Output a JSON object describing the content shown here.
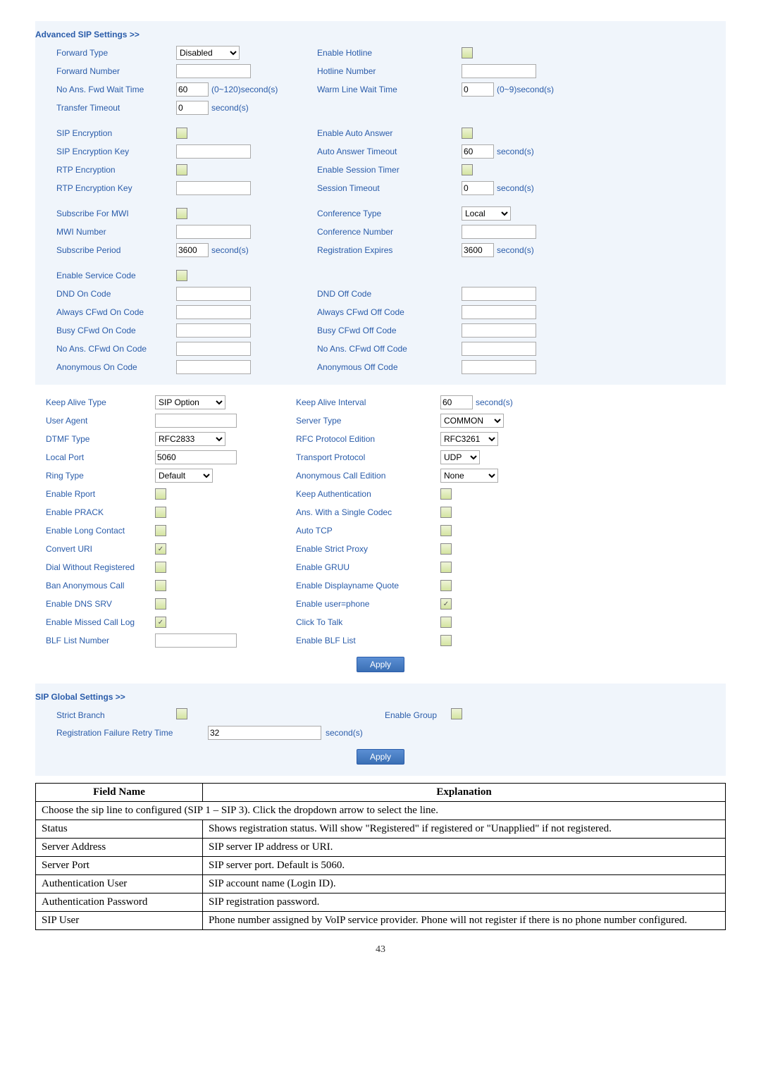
{
  "adv_header": "Advanced SIP Settings >>",
  "labels": {
    "forward_type": "Forward Type",
    "forward_number": "Forward Number",
    "no_ans_fwd_wait": "No Ans. Fwd Wait Time",
    "transfer_timeout": "Transfer Timeout",
    "sip_encryption": "SIP Encryption",
    "sip_enc_key": "SIP Encryption Key",
    "rtp_encryption": "RTP Encryption",
    "rtp_enc_key": "RTP Encryption Key",
    "sub_for_mwi": "Subscribe For MWI",
    "mwi_number": "MWI Number",
    "sub_period": "Subscribe Period",
    "enable_service_code": "Enable Service Code",
    "dnd_on": "DND On Code",
    "always_cfwd_on": "Always CFwd On Code",
    "busy_cfwd_on": "Busy CFwd On Code",
    "no_ans_cfwd_on": "No Ans. CFwd On Code",
    "anon_on": "Anonymous On Code",
    "enable_hotline": "Enable Hotline",
    "hotline_number": "Hotline Number",
    "warm_line_wait": "Warm Line Wait Time",
    "enable_auto_answer": "Enable Auto Answer",
    "auto_answer_timeout": "Auto Answer Timeout",
    "enable_session_timer": "Enable Session Timer",
    "session_timeout": "Session Timeout",
    "conf_type": "Conference Type",
    "conf_number": "Conference Number",
    "reg_expires": "Registration Expires",
    "dnd_off": "DND Off Code",
    "always_cfwd_off": "Always CFwd Off Code",
    "busy_cfwd_off": "Busy CFwd Off Code",
    "no_ans_cfwd_off": "No Ans. CFwd Off Code",
    "anon_off": "Anonymous Off Code",
    "keep_alive_type": "Keep Alive Type",
    "user_agent": "User Agent",
    "dtmf_type": "DTMF Type",
    "local_port": "Local Port",
    "ring_type": "Ring Type",
    "enable_rport": "Enable Rport",
    "enable_prack": "Enable PRACK",
    "enable_long_contact": "Enable Long Contact",
    "convert_uri": "Convert URI",
    "dial_without_reg": "Dial Without Registered",
    "ban_anon_call": "Ban Anonymous Call",
    "enable_dns_srv": "Enable DNS SRV",
    "enable_missed_log": "Enable Missed Call Log",
    "blf_list_number": "BLF List Number",
    "keep_alive_interval": "Keep Alive Interval",
    "server_type": "Server Type",
    "rfc_protocol": "RFC Protocol Edition",
    "transport_protocol": "Transport Protocol",
    "anon_call_edition": "Anonymous Call Edition",
    "keep_auth": "Keep Authentication",
    "ans_single_codec": "Ans. With a Single Codec",
    "auto_tcp": "Auto TCP",
    "enable_strict_proxy": "Enable Strict Proxy",
    "enable_gruu": "Enable GRUU",
    "enable_displayname_quote": "Enable Displayname Quote",
    "enable_user_phone": "Enable user=phone",
    "click_to_talk": "Click To Talk",
    "enable_blf_list": "Enable BLF List"
  },
  "values": {
    "forward_type": "Disabled",
    "no_ans_fwd_wait": "60",
    "no_ans_fwd_wait_unit": "(0~120)second(s)",
    "transfer_timeout": "0",
    "transfer_timeout_unit": "second(s)",
    "warm_line_wait": "0",
    "warm_line_wait_unit": "(0~9)second(s)",
    "auto_answer_timeout": "60",
    "auto_answer_timeout_unit": "second(s)",
    "session_timeout": "0",
    "session_timeout_unit": "second(s)",
    "conf_type": "Local",
    "reg_expires": "3600",
    "reg_expires_unit": "second(s)",
    "sub_period": "3600",
    "sub_period_unit": "second(s)",
    "keep_alive_type": "SIP Option",
    "dtmf_type": "RFC2833",
    "local_port": "5060",
    "ring_type": "Default",
    "keep_alive_interval": "60",
    "keep_alive_interval_unit": "second(s)",
    "server_type": "COMMON",
    "rfc_protocol": "RFC3261",
    "transport_protocol": "UDP",
    "anon_call_edition": "None"
  },
  "global_header": "SIP Global Settings >>",
  "global": {
    "strict_branch": "Strict Branch",
    "enable_group": "Enable Group",
    "reg_fail_retry": "Registration Failure Retry Time",
    "reg_fail_retry_val": "32",
    "reg_fail_retry_unit": "second(s)"
  },
  "apply": "Apply",
  "table": {
    "h1": "Field Name",
    "h2": "Explanation",
    "r0": "Choose the sip line to configured (SIP 1 – SIP 3).    Click the dropdown arrow to select the line.",
    "rows": [
      {
        "f": "Status",
        "e": "Shows registration status.    Will show \"Registered\" if registered or \"Unapplied\" if not registered."
      },
      {
        "f": "Server Address",
        "e": "SIP server IP address or URI."
      },
      {
        "f": "Server Port",
        "e": "SIP server port. Default is 5060."
      },
      {
        "f": "Authentication User",
        "e": "SIP account name (Login ID)."
      },
      {
        "f": "Authentication Password",
        "e": "SIP registration password."
      },
      {
        "f": "SIP User",
        "e": "Phone number assigned by VoIP service provider. Phone will not register if there is no phone number configured."
      }
    ]
  },
  "page_num": "43"
}
